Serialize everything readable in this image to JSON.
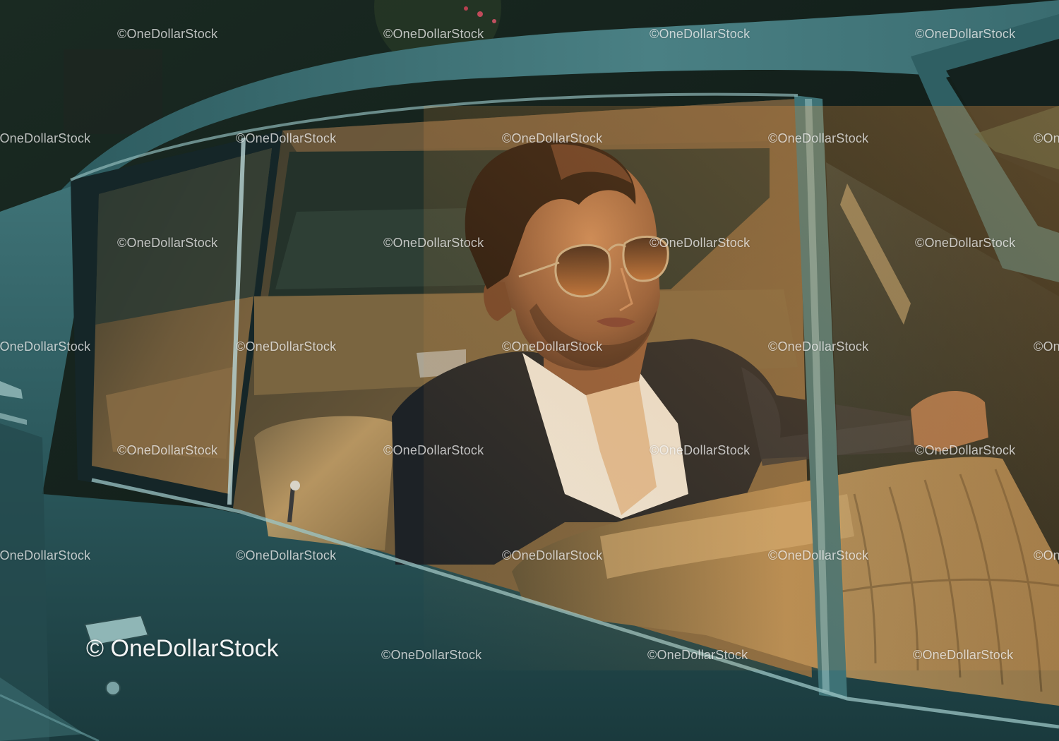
{
  "watermark": {
    "small_text": "©OneDollarStock",
    "large_text": "© OneDollarStock"
  },
  "colors": {
    "car_body": "#2f5f63",
    "car_highlight": "#5c8f92",
    "upholstery": "#b08a55",
    "sunlight": "#d99a4a",
    "jacket": "#1c2024",
    "shirt": "#e8e2d6"
  }
}
